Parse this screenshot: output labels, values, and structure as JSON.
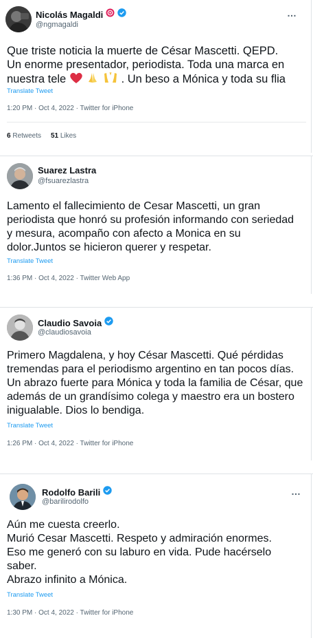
{
  "tweets": [
    {
      "name": "Nicolás Magaldi",
      "handle": "@ngmagaldi",
      "text_lines": [
        "Que triste noticia la muerte de César Mascetti. QEPD.",
        "Un enorme presentador, periodista. Toda una marca en"
      ],
      "text_last_prefix": "nuestra tele ",
      "text_last_suffix": ". Un beso a Mónica y toda su flia",
      "translate": "Translate Tweet",
      "time": "1:20 PM · Oct 4, 2022 · Twitter for iPhone",
      "retweets": "6",
      "retweets_label": " Retweets",
      "likes": "51",
      "likes_label": " Likes"
    },
    {
      "name": "Suarez Lastra",
      "handle": "@fsuarezlastra",
      "text": "Lamento el fallecimiento de Cesar Mascetti, un gran periodista que honró su profesión informando con seriedad y mesura, acompaño con afecto a Monica en su dolor.Juntos se hicieron querer y respetar.",
      "translate": "Translate Tweet",
      "time": "1:36 PM · Oct 4, 2022 · Twitter Web App"
    },
    {
      "name": "Claudio Savoia",
      "handle": "@claudiosavoia",
      "text": "Primero Magdalena, y hoy César Mascetti. Qué pérdidas tremendas para el periodismo argentino en tan pocos días. Un abrazo fuerte para Mónica y toda la familia de César, que además de un grandísimo colega y maestro era un bostero inigualable. Dios lo bendiga.",
      "translate": "Translate Tweet",
      "time": "1:26 PM · Oct 4, 2022 · Twitter for iPhone"
    },
    {
      "name": "Rodolfo Barili",
      "handle": "@barilirodolfo",
      "text_lines": [
        "Aún me cuesta creerlo.",
        "Murió Cesar Mascetti. Respeto y admiración enormes.",
        "Eso me generó con su laburo en vida. Pude hacérselo",
        "saber.",
        "Abrazo infinito a Mónica."
      ],
      "translate": "Translate Tweet",
      "time": "1:30 PM · Oct 4, 2022 · Twitter for iPhone"
    }
  ],
  "more_icon": "…",
  "colors": {
    "link": "#1d9bf0",
    "verified": "#1d9bf0",
    "muted": "#536471"
  }
}
